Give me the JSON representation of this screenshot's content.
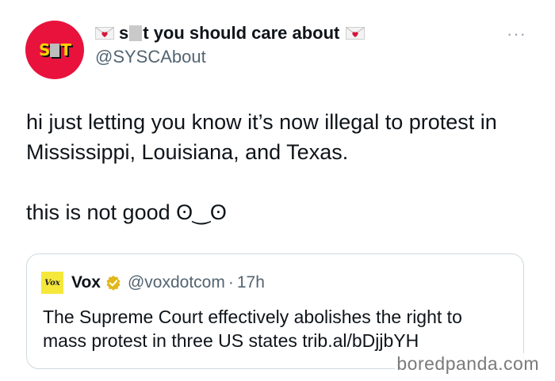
{
  "author": {
    "avatar_text_left": "S",
    "avatar_text_right": "T",
    "name_prefix": "s",
    "name_suffix": "t you should care about",
    "handle": "@SYSCAbout",
    "avatar_color": "#e8123d",
    "left_icon": "heart-envelope-icon",
    "right_icon": "heart-envelope-icon"
  },
  "more_menu": {
    "label": "···",
    "icon": "more-dots-icon"
  },
  "tweet": {
    "paragraph_1": "hi just letting you know it’s now illegal to protest in Mississippi, Louisiana, and Texas.",
    "paragraph_2": "this is not good ʘ‿ʘ"
  },
  "quoted_tweet": {
    "logo_text": "Vox",
    "name": "Vox",
    "handle": "@voxdotcom",
    "separator": "·",
    "time": "17h",
    "text": "The Supreme Court effectively abolishes the right to mass protest in three US states trib.al/bDjjbYH",
    "verified_color": "#e2b719"
  },
  "watermark": {
    "text": "boredpanda.com"
  }
}
